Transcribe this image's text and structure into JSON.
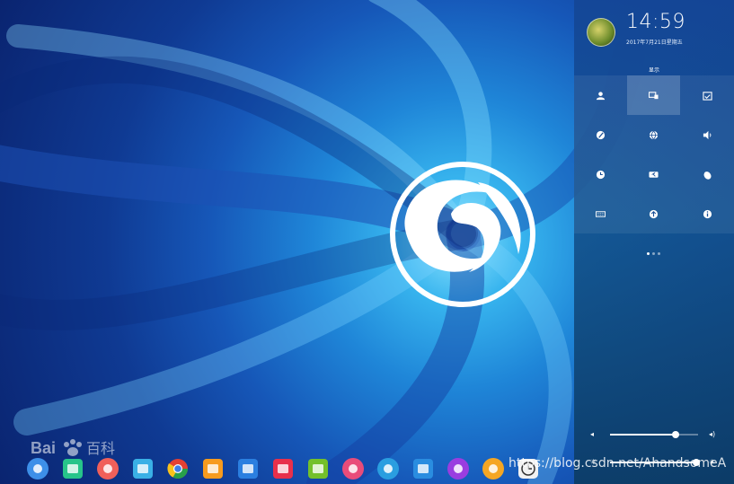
{
  "control_center": {
    "time": "14:59",
    "date": "2017年7月21日星期五",
    "section_label": "显示",
    "tiles": [
      {
        "icon": "user-icon",
        "active": false
      },
      {
        "icon": "display-icon",
        "active": true
      },
      {
        "icon": "calendar-icon",
        "active": false
      },
      {
        "icon": "personalization-icon",
        "active": false
      },
      {
        "icon": "network-icon",
        "active": false
      },
      {
        "icon": "sound-icon",
        "active": false
      },
      {
        "icon": "time-icon",
        "active": false
      },
      {
        "icon": "power-icon",
        "active": false
      },
      {
        "icon": "mouse-icon",
        "active": false
      },
      {
        "icon": "keyboard-icon",
        "active": false
      },
      {
        "icon": "update-icon",
        "active": false
      },
      {
        "icon": "info-icon",
        "active": false
      }
    ],
    "page_count": 3,
    "current_page": 1,
    "volume_level": 0.74,
    "brightness_level": 0.98
  },
  "dock": {
    "apps": [
      {
        "icon": "launcher-icon",
        "color": "#3d8fe8"
      },
      {
        "icon": "file-manager-icon",
        "color": "#27c48a"
      },
      {
        "icon": "store-icon",
        "color": "#f0605a"
      },
      {
        "icon": "app-store-icon",
        "color": "#3ab0e6"
      },
      {
        "icon": "chrome-icon",
        "color": "#e34133"
      },
      {
        "icon": "music-box-icon",
        "color": "#f79b1e"
      },
      {
        "icon": "video-icon",
        "color": "#2b7fe0"
      },
      {
        "icon": "screenshot-icon",
        "color": "#e8304b"
      },
      {
        "icon": "music-icon",
        "color": "#74c02a"
      },
      {
        "icon": "settings-icon",
        "color": "#e94c7a"
      },
      {
        "icon": "camera-icon",
        "color": "#2a9ee0"
      },
      {
        "icon": "system-monitor-icon",
        "color": "#2a8de0"
      },
      {
        "icon": "shutdown-icon",
        "color": "#9a3de0"
      },
      {
        "icon": "browser-icon",
        "color": "#f5a623"
      },
      {
        "icon": "clock-app-icon",
        "color": "#f2f2f2"
      }
    ]
  },
  "watermarks": {
    "baidu": "Bai百科",
    "csdn": "https://blog.csdn.net/AhandsomeA"
  }
}
